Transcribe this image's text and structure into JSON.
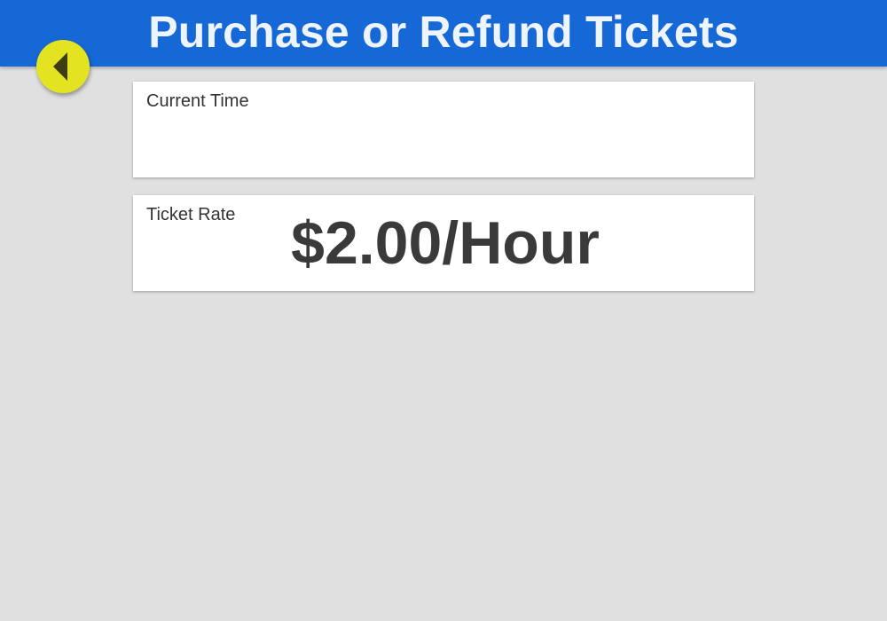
{
  "header": {
    "title": "Purchase or Refund Tickets"
  },
  "back_button": {
    "icon": "triangle-left-icon",
    "color": "#e3e322"
  },
  "current_time": {
    "label": "Current Time",
    "value": ""
  },
  "ticket_rate": {
    "label": "Ticket Rate",
    "value": "$2.00/Hour"
  },
  "colors": {
    "header_bg": "#1668d6",
    "page_bg": "#e0e0e0",
    "card_bg": "#ffffff",
    "accent_yellow": "#e3e322"
  }
}
